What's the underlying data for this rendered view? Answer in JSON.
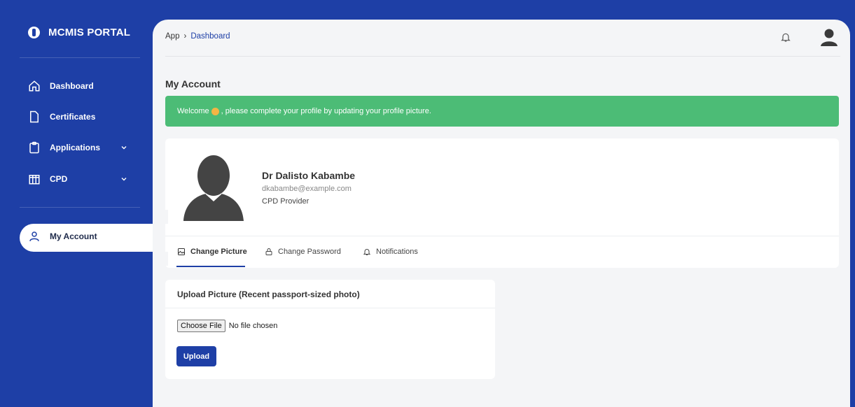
{
  "sidebar": {
    "brand": "MCMIS PORTAL",
    "items": [
      {
        "label": "Dashboard",
        "icon": "home-icon"
      },
      {
        "label": "Certificates",
        "icon": "file-icon"
      },
      {
        "label": "Applications",
        "icon": "clipboard-icon"
      },
      {
        "label": "CPD",
        "icon": "columns-icon"
      }
    ],
    "active_item": {
      "label": "My Account",
      "icon": "user-icon"
    }
  },
  "header": {
    "breadcrumb_root": "App",
    "breadcrumb_separator": "›",
    "breadcrumb_current": "Dashboard"
  },
  "page": {
    "title": "My Account",
    "alert_prefix": "Welcome",
    "alert_suffix": ", please complete your profile by updating your profile picture."
  },
  "profile": {
    "name": "Dr Dalisto Kabambe",
    "email": "dkabambe@example.com",
    "role": "CPD Provider"
  },
  "tabs": [
    {
      "label": "Change Picture",
      "icon": "image-icon"
    },
    {
      "label": "Change Password",
      "icon": "lock-icon"
    },
    {
      "label": "Notifications",
      "icon": "bell-icon"
    }
  ],
  "upload": {
    "title": "Upload Picture (Recent passport-sized photo)",
    "choose_label": "Choose File",
    "file_status": "No file chosen",
    "upload_label": "Upload"
  },
  "colors": {
    "primary": "#1e3fa6",
    "success": "#4cbc76",
    "background": "#f4f5f7"
  }
}
